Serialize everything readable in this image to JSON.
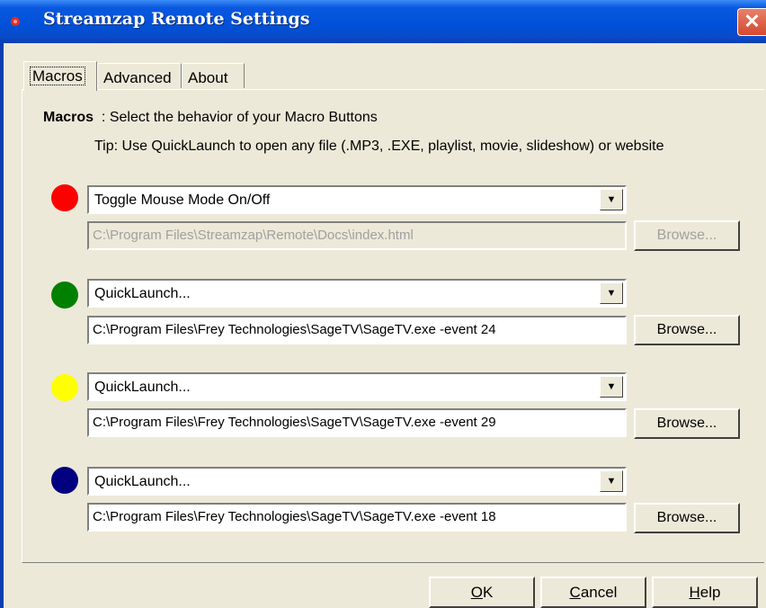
{
  "window": {
    "title": "Streamzap Remote Settings",
    "close_glyph": "✕"
  },
  "tabs": [
    {
      "label": "Macros",
      "active": true
    },
    {
      "label": "Advanced",
      "active": false
    },
    {
      "label": "About",
      "active": false
    }
  ],
  "macros": {
    "heading_bold": "Macros",
    "heading_rest": "  : Select the behavior of your Macro Buttons",
    "tip": "Tip: Use QuickLaunch to open any file (.MP3, .EXE, playlist, movie, slideshow) or website",
    "rows": [
      {
        "color": "#ff0000",
        "action": "Toggle Mouse Mode On/Off",
        "path": "C:\\Program Files\\Streamzap\\Remote\\Docs\\index.html",
        "enabled": false,
        "browse": "Browse..."
      },
      {
        "color": "#008000",
        "action": "QuickLaunch...",
        "path": "C:\\Program Files\\Frey Technologies\\SageTV\\SageTV.exe -event 24",
        "enabled": true,
        "browse": "Browse..."
      },
      {
        "color": "#ffff00",
        "action": "QuickLaunch...",
        "path": "C:\\Program Files\\Frey Technologies\\SageTV\\SageTV.exe -event 29",
        "enabled": true,
        "browse": "Browse..."
      },
      {
        "color": "#000080",
        "action": "QuickLaunch...",
        "path": "C:\\Program Files\\Frey Technologies\\SageTV\\SageTV.exe -event 18",
        "enabled": true,
        "browse": "Browse..."
      }
    ]
  },
  "buttons": {
    "ok": {
      "underline": "O",
      "rest": "K"
    },
    "cancel": {
      "underline": "C",
      "rest": "ancel"
    },
    "help": {
      "underline": "H",
      "rest": "elp"
    }
  },
  "icons": {
    "title": "app-icon",
    "dropdown": "chevron-down-icon"
  }
}
